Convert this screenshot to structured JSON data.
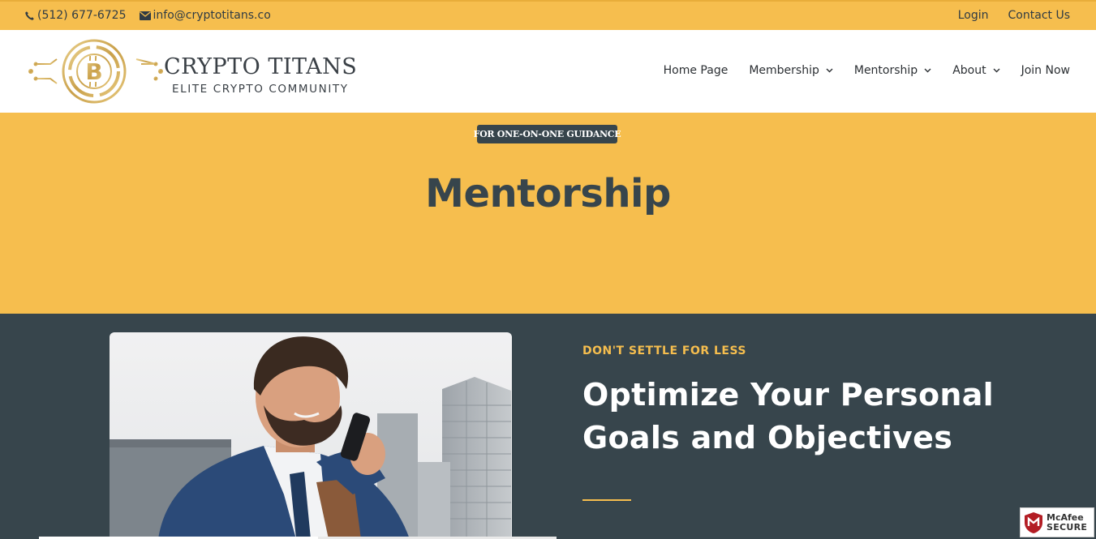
{
  "topbar": {
    "phone": "(512) 677-6725",
    "email": "info@cryptotitans.co",
    "login": "Login",
    "contact_us": "Contact Us"
  },
  "brand": {
    "title": "CRYPTO TITANS",
    "subtitle": "ELITE CRYPTO COMMUNITY"
  },
  "nav": {
    "items": [
      {
        "label": "Home Page",
        "dropdown": false
      },
      {
        "label": "Membership",
        "dropdown": true
      },
      {
        "label": "Mentorship",
        "dropdown": true
      },
      {
        "label": "About",
        "dropdown": true
      },
      {
        "label": "Join Now",
        "dropdown": false
      }
    ]
  },
  "hero": {
    "badge": "FOR ONE-ON-ONE GUIDANCE",
    "title": "Mentorship"
  },
  "section": {
    "eyebrow": "DON'T SETTLE FOR LESS",
    "headline_line1": "Optimize Your Personal",
    "headline_line2": "Goals and Objectives"
  },
  "mcafee": {
    "line1": "McAfee",
    "line2": "SECURE"
  },
  "colors": {
    "accent": "#f6be4e",
    "dark": "#37454c",
    "text": "#2f3b44"
  }
}
